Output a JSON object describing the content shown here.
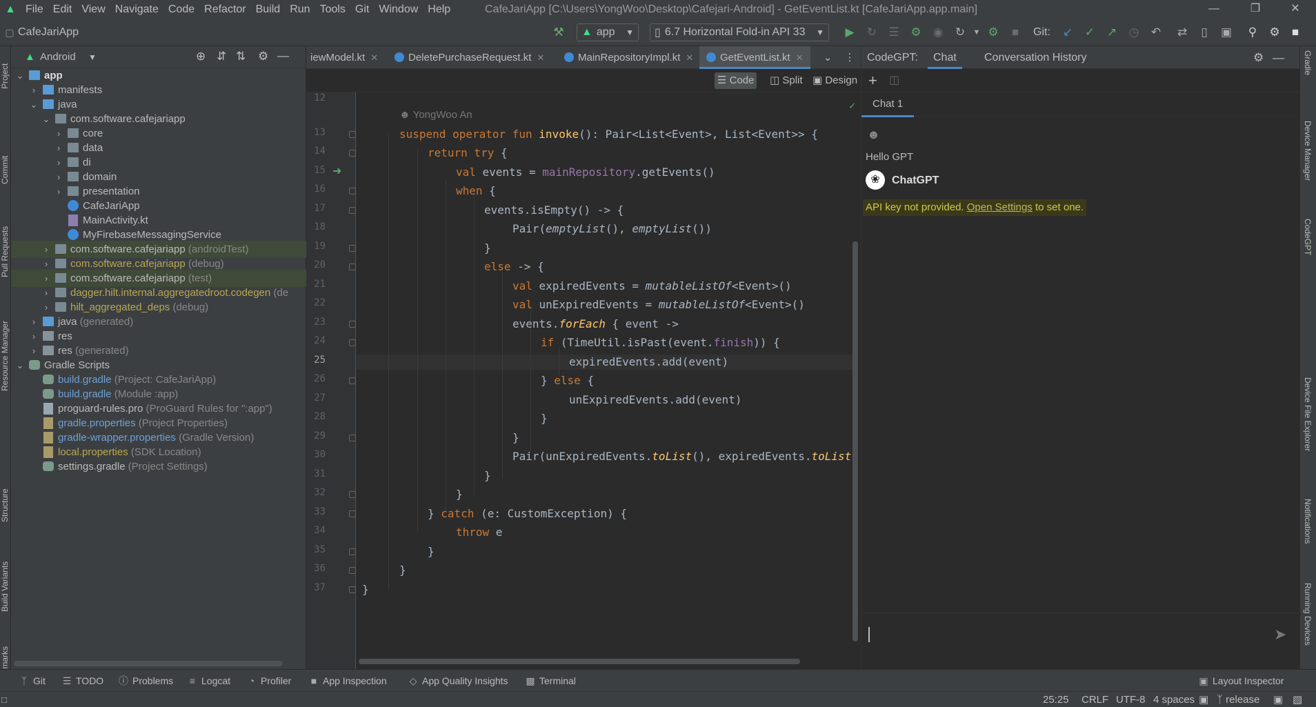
{
  "menubar": {
    "items": [
      "File",
      "Edit",
      "View",
      "Navigate",
      "Code",
      "Refactor",
      "Build",
      "Run",
      "Tools",
      "Git",
      "Window",
      "Help"
    ],
    "window_title": "CafeJariApp [C:\\Users\\YongWoo\\Desktop\\Cafejari-Android] - GetEventList.kt [CafeJariApp.app.main]"
  },
  "toolbar": {
    "project": "CafeJariApp",
    "run_config": "app",
    "device": "6.7  Horizontal Fold-in API 33",
    "git_label": "Git:"
  },
  "left_strip": [
    "Project",
    "Commit",
    "Pull Requests",
    "Resource Manager",
    "Structure",
    "Build Variants",
    "Bookmarks"
  ],
  "right_strip": [
    "Gradle",
    "Device Manager",
    "CodeGPT",
    "Device File Explorer",
    "Notifications",
    "Running Devices"
  ],
  "project_panel": {
    "view": "Android",
    "tree": [
      {
        "label": "app",
        "suffix": ""
      },
      {
        "label": "manifests",
        "suffix": ""
      },
      {
        "label": "java",
        "suffix": ""
      },
      {
        "label": "com.software.cafejariapp",
        "suffix": ""
      },
      {
        "label": "core",
        "suffix": ""
      },
      {
        "label": "data",
        "suffix": ""
      },
      {
        "label": "di",
        "suffix": ""
      },
      {
        "label": "domain",
        "suffix": ""
      },
      {
        "label": "presentation",
        "suffix": ""
      },
      {
        "label": "CafeJariApp",
        "suffix": ""
      },
      {
        "label": "MainActivity.kt",
        "suffix": ""
      },
      {
        "label": "MyFirebaseMessagingService",
        "suffix": ""
      },
      {
        "label": "com.software.cafejariapp",
        "suffix": "(androidTest)"
      },
      {
        "label": "com.software.cafejariapp",
        "suffix": "(debug)"
      },
      {
        "label": "com.software.cafejariapp",
        "suffix": "(test)"
      },
      {
        "label": "dagger.hilt.internal.aggregatedroot.codegen",
        "suffix": "(de"
      },
      {
        "label": "hilt_aggregated_deps",
        "suffix": "(debug)"
      },
      {
        "label": "java",
        "suffix": "(generated)"
      },
      {
        "label": "res",
        "suffix": ""
      },
      {
        "label": "res",
        "suffix": "(generated)"
      },
      {
        "label": "Gradle Scripts",
        "suffix": ""
      },
      {
        "label": "build.gradle",
        "suffix": "(Project: CafeJariApp)"
      },
      {
        "label": "build.gradle",
        "suffix": "(Module :app)"
      },
      {
        "label": "proguard-rules.pro",
        "suffix": "(ProGuard Rules for \":app\")"
      },
      {
        "label": "gradle.properties",
        "suffix": "(Project Properties)"
      },
      {
        "label": "gradle-wrapper.properties",
        "suffix": "(Gradle Version)"
      },
      {
        "label": "local.properties",
        "suffix": "(SDK Location)"
      },
      {
        "label": "settings.gradle",
        "suffix": "(Project Settings)"
      }
    ]
  },
  "editor": {
    "tabs": [
      "iewModel.kt",
      "DeletePurchaseRequest.kt",
      "MainRepositoryImpl.kt",
      "GetEventList.kt"
    ],
    "modes": [
      "Code",
      "Split",
      "Design"
    ],
    "author": "YongWoo An",
    "line_numbers": [
      "12",
      "13",
      "14",
      "15",
      "16",
      "17",
      "18",
      "19",
      "20",
      "21",
      "22",
      "23",
      "24",
      "25",
      "26",
      "27",
      "28",
      "29",
      "30",
      "31",
      "32",
      "33",
      "34",
      "35",
      "36",
      "37"
    ],
    "current_line": "25"
  },
  "codegpt": {
    "title": "CodeGPT:",
    "tabs": [
      "Chat",
      "Conversation History"
    ],
    "chat_tab": "Chat 1",
    "user_message": "Hello GPT",
    "bot_name": "ChatGPT",
    "error_prefix": "API key not provided.",
    "error_link": "Open Settings",
    "error_suffix": "to set one."
  },
  "bottom_tools": [
    "Git",
    "TODO",
    "Problems",
    "Logcat",
    "Profiler",
    "App Inspection",
    "App Quality Insights",
    "Terminal",
    "Layout Inspector"
  ],
  "status_bar": {
    "position": "25:25",
    "line_sep": "CRLF",
    "encoding": "UTF-8",
    "indent": "4 spaces",
    "branch": "release"
  },
  "colors": {
    "keyword": "#cc7832",
    "function": "#ffc66d",
    "property": "#9876aa",
    "accent": "#4a88c7",
    "warning_bg": "#3a3a1a",
    "warning_text": "#d4c84a"
  }
}
